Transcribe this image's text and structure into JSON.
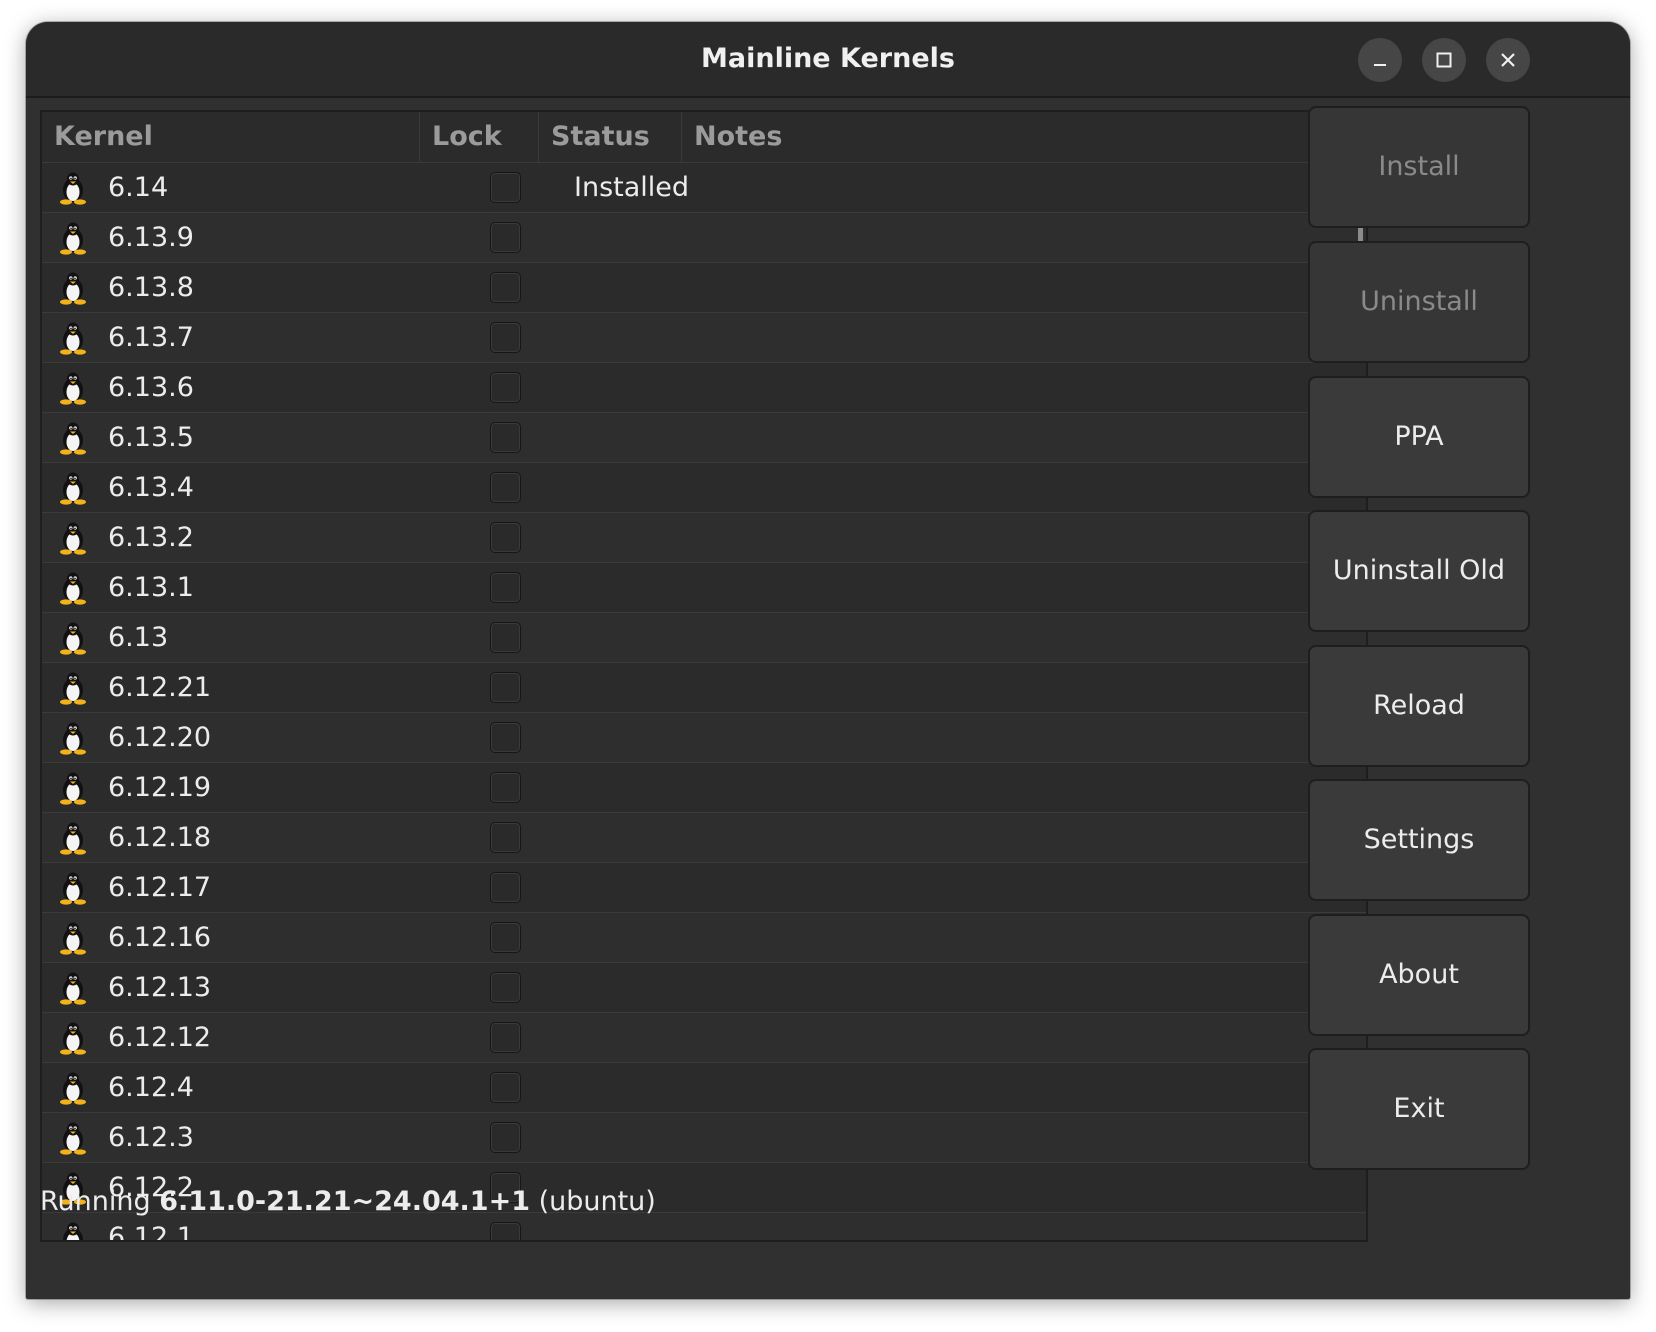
{
  "window": {
    "title": "Mainline Kernels"
  },
  "columns": {
    "kernel": "Kernel",
    "lock": "Lock",
    "status": "Status",
    "notes": "Notes"
  },
  "kernels": [
    {
      "version": "6.14",
      "status": "Installed"
    },
    {
      "version": "6.13.9",
      "status": ""
    },
    {
      "version": "6.13.8",
      "status": ""
    },
    {
      "version": "6.13.7",
      "status": ""
    },
    {
      "version": "6.13.6",
      "status": ""
    },
    {
      "version": "6.13.5",
      "status": ""
    },
    {
      "version": "6.13.4",
      "status": ""
    },
    {
      "version": "6.13.2",
      "status": ""
    },
    {
      "version": "6.13.1",
      "status": ""
    },
    {
      "version": "6.13",
      "status": ""
    },
    {
      "version": "6.12.21",
      "status": ""
    },
    {
      "version": "6.12.20",
      "status": ""
    },
    {
      "version": "6.12.19",
      "status": ""
    },
    {
      "version": "6.12.18",
      "status": ""
    },
    {
      "version": "6.12.17",
      "status": ""
    },
    {
      "version": "6.12.16",
      "status": ""
    },
    {
      "version": "6.12.13",
      "status": ""
    },
    {
      "version": "6.12.12",
      "status": ""
    },
    {
      "version": "6.12.4",
      "status": ""
    },
    {
      "version": "6.12.3",
      "status": ""
    },
    {
      "version": "6.12.2",
      "status": ""
    },
    {
      "version": "6.12.1",
      "status": ""
    }
  ],
  "buttons": {
    "install": "Install",
    "uninstall": "Uninstall",
    "ppa": "PPA",
    "uninstall_old": "Uninstall Old",
    "reload": "Reload",
    "settings": "Settings",
    "about": "About",
    "exit": "Exit"
  },
  "statusbar": {
    "prefix": "Running ",
    "version": "6.11.0-21.21~24.04.1+1",
    "suffix": " (ubuntu)"
  },
  "icons": {
    "row_icon": "tux-penguin-icon",
    "minimize": "minimize-icon",
    "maximize": "maximize-icon",
    "close": "close-icon"
  }
}
